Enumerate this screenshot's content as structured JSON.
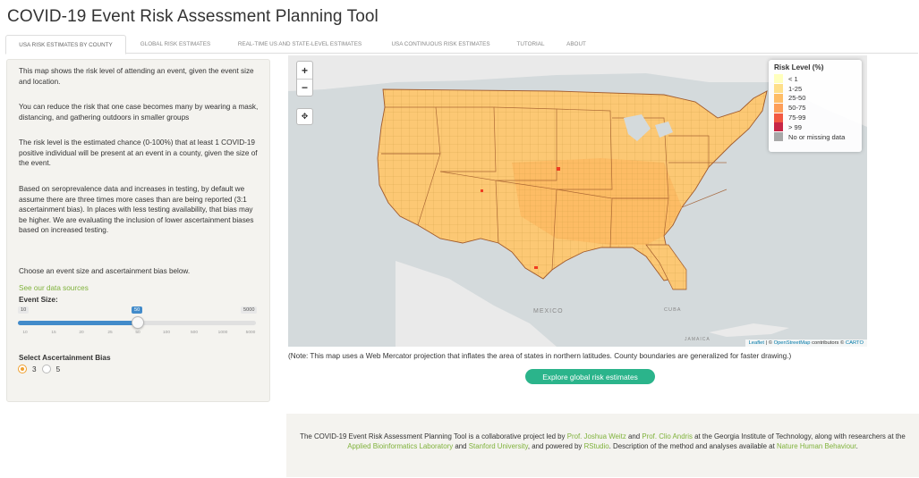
{
  "app": {
    "title": "COVID-19 Event Risk Assessment Planning Tool"
  },
  "tabs": [
    {
      "label": "USA RISK ESTIMATES BY COUNTY",
      "active": true
    },
    {
      "label": "GLOBAL RISK ESTIMATES",
      "active": false
    },
    {
      "label": "REAL-TIME US AND STATE-LEVEL ESTIMATES",
      "active": false
    },
    {
      "label": "USA CONTINUOUS RISK ESTIMATES",
      "active": false
    },
    {
      "label": "TUTORIAL",
      "active": false
    },
    {
      "label": "ABOUT",
      "active": false
    }
  ],
  "sidebar": {
    "p1": "This map shows the risk level of attending an event, given the event size and location.",
    "p2": "You can reduce the risk that one case becomes many by wearing a mask, distancing, and gathering outdoors in smaller groups",
    "p3": "The risk level is the estimated chance (0-100%) that at least 1 COVID-19 positive individual will be present at an event in a county, given the size of the event.",
    "p4": "Based on seroprevalence data and increases in testing, by default we assume there are three times more cases than are being reported (3:1 ascertainment bias). In places with less testing availability, that bias may be higher. We are evaluating the inclusion of lower ascertainment biases based on increased testing.",
    "p5": "Choose an event size and ascertainment bias below.",
    "data_sources_link": "See our data sources",
    "event_size_label": "Event Size:",
    "slider": {
      "min_label": "10",
      "max_label": "5000",
      "value_label": "50",
      "value": 50,
      "ticks": [
        "10",
        "15",
        "20",
        "25",
        "50",
        "100",
        "500",
        "1000",
        "5000"
      ]
    },
    "bias_label": "Select Ascertainment Bias",
    "bias_options": [
      {
        "label": "3",
        "selected": true
      },
      {
        "label": "5",
        "selected": false
      }
    ]
  },
  "map": {
    "zoom_in": "+",
    "zoom_out": "−",
    "locate_icon": "✥",
    "labels": {
      "mexico": "MEXICO",
      "cuba": "CUBA",
      "jamaica": "JAMAICA"
    },
    "legend": {
      "title": "Risk Level (%)",
      "items": [
        {
          "label": "< 1",
          "color": "#ffffb2"
        },
        {
          "label": "1-25",
          "color": "#fed976"
        },
        {
          "label": "25-50",
          "color": "#feb24c"
        },
        {
          "label": "50-75",
          "color": "#fd8d3c"
        },
        {
          "label": "75-99",
          "color": "#f03b20"
        },
        {
          "label": "> 99",
          "color": "#bd0026"
        },
        {
          "label": "No or missing data",
          "color": "#999999"
        }
      ]
    },
    "attribution": {
      "leaflet": "Leaflet",
      "sep1": " | © ",
      "osm": "OpenStreetMap",
      "mid": " contributors © ",
      "carto": "CARTO"
    }
  },
  "note": "(Note: This map uses a Web Mercator projection that inflates the area of states in northern latitudes. County boundaries are generalized for faster drawing.)",
  "global_button": "Explore global risk estimates",
  "footer": {
    "t1": "The COVID-19 Event Risk Assessment Planning Tool is a collaborative project led by ",
    "l1": "Prof. Joshua Weitz",
    "t2": " and ",
    "l2": "Prof. Clio Andris",
    "t3": " at the Georgia Institute of Technology, along with researchers at the ",
    "l3": "Applied Bioinformatics Laboratory",
    "t4": " and ",
    "l4": "Stanford University",
    "t5": ", and powered by ",
    "l5": "RStudio",
    "t6": ". Description of the method and analyses available at ",
    "l6": "Nature Human Behaviour",
    "t7": "."
  }
}
